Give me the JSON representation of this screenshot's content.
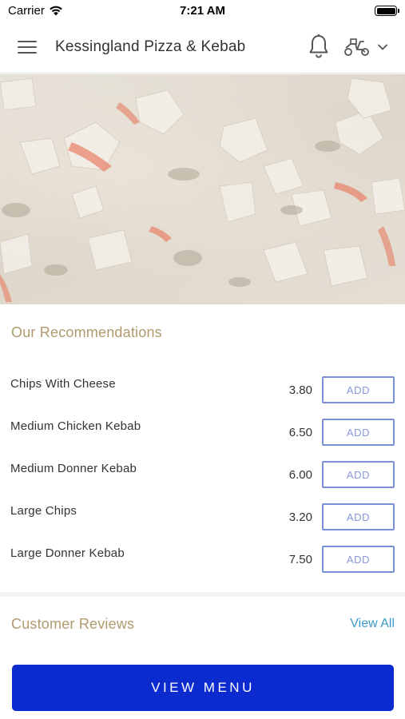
{
  "status_bar": {
    "carrier": "Carrier",
    "time": "7:21 AM"
  },
  "header": {
    "title": "Kessingland Pizza & Kebab",
    "icons": [
      "menu-icon",
      "bell-icon",
      "scooter-icon",
      "chevron-down-icon"
    ]
  },
  "hero": {
    "image": "pizza-with-chicken-photo"
  },
  "recommendations": {
    "title": "Our Recommendations",
    "add_label": "ADD",
    "items": [
      {
        "name": "Chips With Cheese",
        "price": "3.80"
      },
      {
        "name": "Medium Chicken Kebab",
        "price": "6.50"
      },
      {
        "name": "Medium Donner Kebab",
        "price": "6.00"
      },
      {
        "name": "Large Chips",
        "price": "3.20"
      },
      {
        "name": "Large Donner Kebab",
        "price": "7.50"
      }
    ]
  },
  "reviews": {
    "title": "Customer Reviews",
    "view_all": "View All"
  },
  "cta": {
    "label": "VIEW MENU"
  },
  "colors": {
    "accent_gold": "#b09a6e",
    "button_blue": "#0b2bcf",
    "add_border": "#7b8fd6",
    "link_blue": "#3a9bc9"
  }
}
